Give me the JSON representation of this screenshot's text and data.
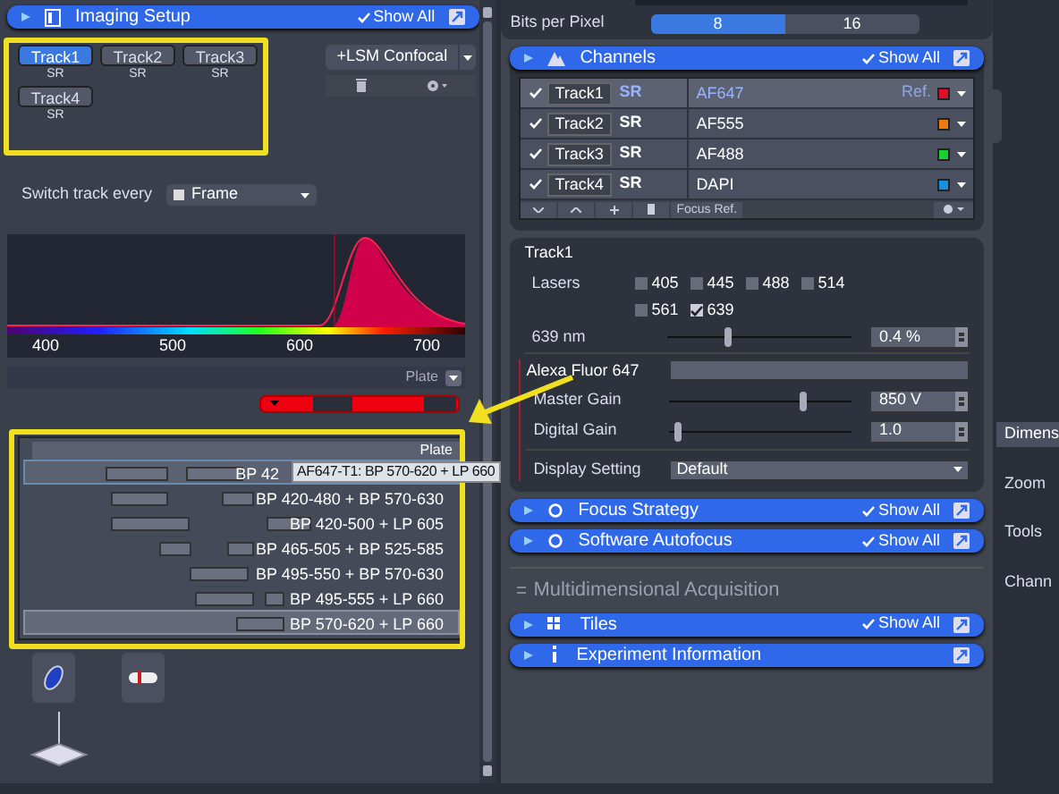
{
  "imaging_setup": {
    "title": "Imaging Setup",
    "show_all": "Show All",
    "tracks": [
      {
        "label": "Track1",
        "mode": "SR",
        "selected": true
      },
      {
        "label": "Track2",
        "mode": "SR",
        "selected": false
      },
      {
        "label": "Track3",
        "mode": "SR",
        "selected": false
      },
      {
        "label": "Track4",
        "mode": "SR",
        "selected": false
      }
    ],
    "add_button": "+LSM Confocal",
    "switch_label": "Switch track every",
    "switch_value": "Frame",
    "spectrum_ticks": [
      "400",
      "500",
      "600",
      "700"
    ],
    "plate_label": "Plate",
    "filter_list": {
      "header": "Plate",
      "rows": [
        {
          "label": "BP 42",
          "selected": true,
          "hovered": false
        },
        {
          "label": "BP 420-480 + BP 570-630",
          "selected": false,
          "hovered": false
        },
        {
          "label": "BP 420-500 + LP 605",
          "selected": false,
          "hovered": false
        },
        {
          "label": "BP 465-505 + BP 525-585",
          "selected": false,
          "hovered": false
        },
        {
          "label": "BP 495-550 + BP 570-630",
          "selected": false,
          "hovered": false
        },
        {
          "label": "BP 495-555 + LP 660",
          "selected": false,
          "hovered": false
        },
        {
          "label": "BP 570-620 + LP 660",
          "selected": false,
          "hovered": true
        }
      ]
    },
    "tooltip": "AF647-T1: BP 570-620 + LP 660"
  },
  "acquisition": {
    "bits_label": "Bits per Pixel",
    "bits_options": [
      {
        "label": "8",
        "selected": true
      },
      {
        "label": "16",
        "selected": false
      }
    ],
    "channels": {
      "title": "Channels",
      "show_all": "Show All",
      "rows": [
        {
          "track": "Track1",
          "mode": "SR",
          "dye": "AF647",
          "ref": "Ref.",
          "color": "#e0102a",
          "checked": true,
          "selected": true
        },
        {
          "track": "Track2",
          "mode": "SR",
          "dye": "AF555",
          "color": "#f07a10",
          "checked": true,
          "selected": false
        },
        {
          "track": "Track3",
          "mode": "SR",
          "dye": "AF488",
          "color": "#18d030",
          "checked": true,
          "selected": false
        },
        {
          "track": "Track4",
          "mode": "SR",
          "dye": "DAPI",
          "color": "#1890e0",
          "checked": true,
          "selected": false
        }
      ],
      "focus_ref": "Focus Ref."
    },
    "track_title": "Track1",
    "lasers_label": "Lasers",
    "lasers": [
      {
        "label": "405",
        "checked": false
      },
      {
        "label": "445",
        "checked": false
      },
      {
        "label": "488",
        "checked": false
      },
      {
        "label": "514",
        "checked": false
      },
      {
        "label": "561",
        "checked": false
      },
      {
        "label": "639",
        "checked": true
      }
    ],
    "laser_power": {
      "label": "639 nm",
      "level": 0.33,
      "value": "0.4 %"
    },
    "dye_label": "Alexa Fluor 647",
    "master_gain": {
      "label": "Master Gain",
      "level": 0.73,
      "value": "850 V"
    },
    "digital_gain": {
      "label": "Digital Gain",
      "level": 0.05,
      "value": "1.0"
    },
    "display_setting": {
      "label": "Display Setting",
      "value": "Default"
    },
    "tools": [
      {
        "title": "Focus Strategy",
        "show_all": "Show All"
      },
      {
        "title": "Software Autofocus",
        "show_all": "Show All"
      }
    ],
    "section_title": "Multidimensional Acquisition",
    "tools2": [
      {
        "title": "Tiles",
        "show_all": "Show All"
      },
      {
        "title": "Experiment Information"
      }
    ]
  },
  "side_tabs": [
    {
      "label": "Dimens",
      "selected": true
    },
    {
      "label": "Zoom",
      "selected": false
    },
    {
      "label": "Tools",
      "selected": false
    },
    {
      "label": "Chann",
      "selected": false
    }
  ]
}
